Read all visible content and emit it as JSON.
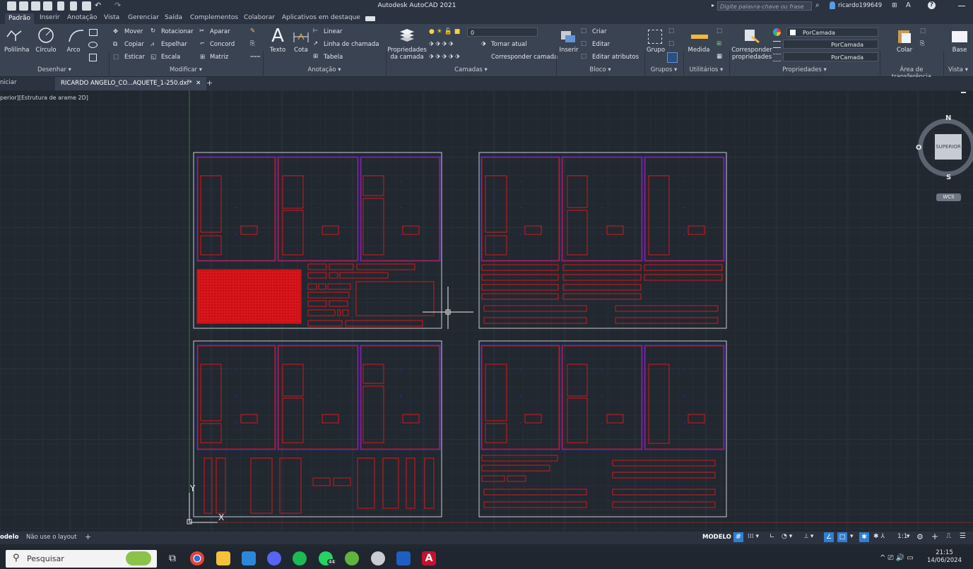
{
  "app": {
    "title": "Autodesk AutoCAD 2021",
    "search_placeholder": "Digite palavra-chave ou frase",
    "user": "ricardo199649"
  },
  "ribbon_tabs": [
    "Padrão",
    "Inserir",
    "Anotação",
    "Vista",
    "Gerenciar",
    "Saída",
    "Complementos",
    "Colaborar",
    "Aplicativos em destaque"
  ],
  "ribbon": {
    "draw": {
      "polilinha": "Polilinha",
      "circulo": "Círculo",
      "arco": "Arco",
      "title": "Desenhar ▾"
    },
    "modify": {
      "mover": "Mover",
      "rotacionar": "Rotacionar",
      "aparar": "Aparar",
      "copiar": "Copiar",
      "espelhar": "Espelhar",
      "concord": "Concord",
      "esticar": "Esticar",
      "escala": "Escala",
      "matriz": "Matriz",
      "title": "Modificar ▾"
    },
    "annotation": {
      "texto": "Texto",
      "cota": "Cota",
      "linear": "Linear",
      "linha_chamada": "Linha de chamada",
      "tabela": "Tabela",
      "title": "Anotação ▾"
    },
    "layers": {
      "propriedades": "Propriedades",
      "da_camada": "da camada",
      "current_layer": "0",
      "tornar_atual": "Tornar atual",
      "corresponder_camada": "Corresponder camada",
      "title": "Camadas ▾"
    },
    "block": {
      "inserir": "Inserir",
      "criar": "Criar",
      "editar": "Editar",
      "editar_atributos": "Editar atributos",
      "title": "Bloco ▾"
    },
    "groups": {
      "grupo": "Grupo",
      "title": "Grupos ▾"
    },
    "utilities": {
      "medida": "Medida",
      "title": "Utilitários ▾"
    },
    "properties": {
      "corresponder": "Corresponder",
      "propriedades": "propriedades",
      "color": "PorCamada",
      "linetype": "PorCamada",
      "lineweight": "PorCamada",
      "title": "Propriedades ▾"
    },
    "clipboard": {
      "colar": "Colar",
      "title": "Área de transferência"
    },
    "view": {
      "base": "Base",
      "title": "Vista ▾"
    }
  },
  "doc_tabs": {
    "start": "niciar",
    "active": "RICARDO ANGELO_CO...AQUETE_1-250.dxf*",
    "close": "✕",
    "add": "+"
  },
  "viewport_label": "perior][Estrutura de arame 2D]",
  "viewcube": {
    "n": "N",
    "s": "S",
    "o": "O",
    "face": "SUPERIOR",
    "wcs": "WCS"
  },
  "ucs": {
    "x": "X",
    "y": "Y"
  },
  "layout_tabs": [
    "odelo",
    "Não use o layout"
  ],
  "layout_add": "+",
  "status": {
    "modelo": "MODELO",
    "scale": "1:1"
  },
  "taskbar": {
    "search": "Pesquisar",
    "whatsapp_badge": "44",
    "time": "21:15",
    "date": "14/06/2024"
  },
  "colors": {
    "accent": "#2f7fd3",
    "drawing_red": "#d8161b",
    "drawing_blue": "#3c2ad8",
    "frame": "#c9ccd1"
  }
}
